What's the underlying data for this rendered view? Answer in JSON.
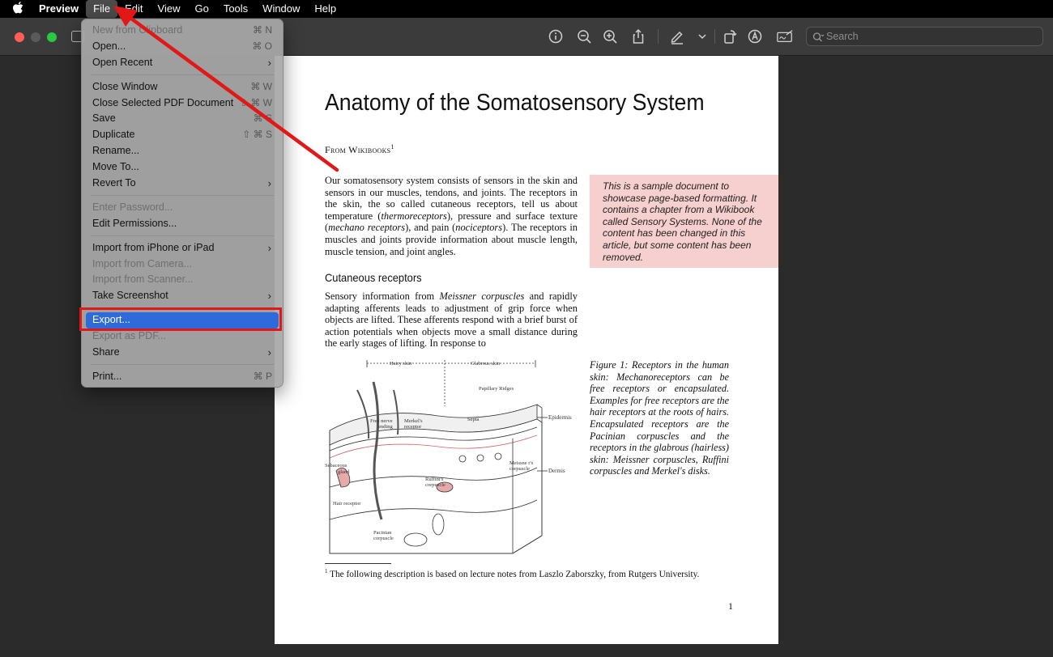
{
  "menubar": {
    "app": "Preview",
    "items": [
      "File",
      "Edit",
      "View",
      "Go",
      "Tools",
      "Window",
      "Help"
    ]
  },
  "toolbar": {
    "search_placeholder": "Search",
    "icons": [
      "info-icon",
      "zoom-out-icon",
      "zoom-in-icon",
      "share-icon",
      "markup-pen-icon",
      "chevron-down-icon",
      "rotate-icon",
      "annotate-icon",
      "signature-icon"
    ]
  },
  "file_menu": {
    "new_from_clipboard": "New from Clipboard",
    "new_from_clipboard_sc": "⌘ N",
    "open": "Open...",
    "open_sc": "⌘ O",
    "open_recent": "Open Recent",
    "close_window": "Close Window",
    "close_window_sc": "⌘ W",
    "close_pdf": "Close Selected PDF Document",
    "close_pdf_sc": "⇧ ⌘ W",
    "save": "Save",
    "save_sc": "⌘ S",
    "duplicate": "Duplicate",
    "duplicate_sc": "⇧ ⌘ S",
    "rename": "Rename...",
    "move_to": "Move To...",
    "revert_to": "Revert To",
    "enter_password": "Enter Password...",
    "edit_permissions": "Edit Permissions...",
    "import_iphone": "Import from iPhone or iPad",
    "import_camera": "Import from Camera...",
    "import_scanner": "Import from Scanner...",
    "take_screenshot": "Take Screenshot",
    "export": "Export...",
    "export_pdf": "Export as PDF...",
    "share": "Share",
    "print": "Print...",
    "print_sc": "⌘ P",
    "highlight_color": "#e01818"
  },
  "document": {
    "title": "Anatomy of the Somatosensory System",
    "from": "From Wikibooks",
    "from_sup": "1",
    "para1_a": "Our somatosensory system consists of sensors in the skin and sensors in our muscles, tendons, and joints. The receptors in the skin, the so called cutaneous receptors, tell us about temperature (",
    "para1_i1": "thermoreceptors",
    "para1_b": "), pressure and surface texture (",
    "para1_i2": "mechano receptors",
    "para1_c": "), and pain (",
    "para1_i3": "nociceptors",
    "para1_d": "). The receptors in muscles and joints provide information about muscle length, muscle tension, and joint angles.",
    "note": "This is a sample document to showcase page-based formatting. It contains a chapter from a Wikibook called Sensory Systems. None of the content has been changed in this article, but some content has been removed.",
    "heading": "Cutaneous receptors",
    "para2_a": "Sensory information from ",
    "para2_i": "Meissner corpuscles",
    "para2_b": " and rapidly adapting afferents leads to adjustment of grip force when objects are lifted. These afferents respond with a brief burst of action potentials when objects move a small distance during the early stages of lifting. In response to",
    "figure_labels": {
      "hairy": "Hairy skin",
      "glabrous": "Glabrous skin",
      "papillary": "Papillary Ridges",
      "epidermis": "Epidermis",
      "dermis": "Dermis",
      "free_nerve": "Free nerve",
      "ending": "ending",
      "merkel": "Merkel's",
      "receptor": "receptor",
      "septa": "Septa",
      "sebaceous": "Sebaceous",
      "gland": "gland",
      "ruffini": "Ruffini's",
      "corpuscle": "corpuscle",
      "meissner": "Meissne r's",
      "hair_receptor": "Hair receptor",
      "pacinian": "Pacinian"
    },
    "caption": "Figure 1:  Receptors in the human skin: Mechanoreceptors can be free receptors or encapsulated. Examples for free receptors are the hair receptors at the roots of hairs. Encapsulated receptors are the Pacinian corpuscles and the receptors in the glabrous (hairless) skin: Meissner corpuscles, Ruffini corpuscles and Merkel's disks.",
    "footnote_sup": "1",
    "footnote": "The following description is based on lecture notes from Laszlo Zaborszky, from Rutgers University.",
    "page_number": "1"
  }
}
